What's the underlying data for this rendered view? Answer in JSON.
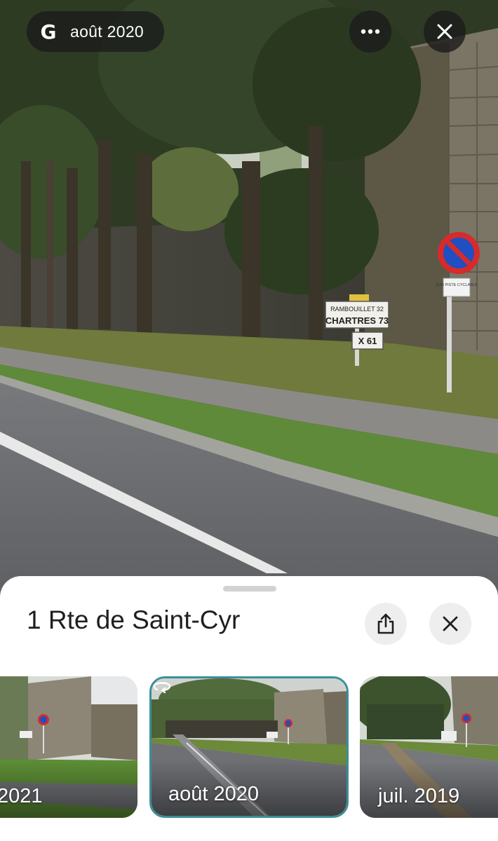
{
  "top_bar": {
    "logo_letter": "G",
    "date_label": "août 2020",
    "more_icon": "more-horizontal-icon",
    "close_icon": "close-icon"
  },
  "photo": {
    "signs": {
      "direction_line1": "RAMBOUILLET 32",
      "direction_line2": "CHARTRES 73",
      "direction_line3": "X 61",
      "sub_plate": "SUR PISTE CYCLABLE"
    }
  },
  "sheet": {
    "address": "1 Rte de Saint-Cyr",
    "share_icon": "share-icon",
    "close_icon": "close-icon"
  },
  "history": [
    {
      "date": "2021",
      "selected": false
    },
    {
      "date": "août 2020",
      "selected": true
    },
    {
      "date": "juil. 2019",
      "selected": false
    }
  ],
  "colors": {
    "selected_border": "#3a8f99",
    "no_parking_red": "#d62b2b",
    "no_parking_blue": "#1f4fc0"
  }
}
